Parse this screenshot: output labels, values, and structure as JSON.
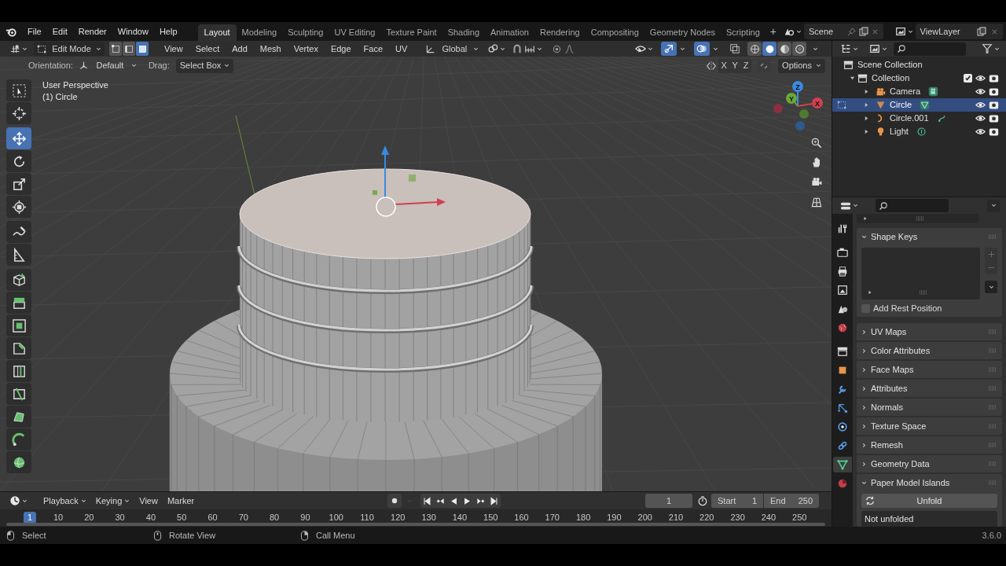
{
  "top_bar": {
    "menus": [
      "File",
      "Edit",
      "Render",
      "Window",
      "Help"
    ],
    "workspaces": [
      {
        "label": "Layout",
        "selected": true
      },
      {
        "label": "Modeling",
        "selected": false
      },
      {
        "label": "Sculpting",
        "selected": false
      },
      {
        "label": "UV Editing",
        "selected": false
      },
      {
        "label": "Texture Paint",
        "selected": false
      },
      {
        "label": "Shading",
        "selected": false
      },
      {
        "label": "Animation",
        "selected": false
      },
      {
        "label": "Rendering",
        "selected": false
      },
      {
        "label": "Compositing",
        "selected": false
      },
      {
        "label": "Geometry Nodes",
        "selected": false
      },
      {
        "label": "Scripting",
        "selected": false
      }
    ],
    "add_workspace": "+",
    "scene": "Scene",
    "view_layer": "ViewLayer"
  },
  "viewport_header": {
    "mode": "Edit Mode",
    "select_modes": [
      {
        "kind": "vertex",
        "selected": false
      },
      {
        "kind": "edge",
        "selected": false
      },
      {
        "kind": "face",
        "selected": true
      }
    ],
    "menus": [
      "View",
      "Select",
      "Add",
      "Mesh",
      "Vertex",
      "Edge",
      "Face",
      "UV"
    ],
    "orientation": "Global",
    "toggles": [
      {
        "kind": "gizmo",
        "on": true
      },
      {
        "kind": "overlay",
        "on": true
      },
      {
        "kind": "xray",
        "on": false
      }
    ],
    "shading": [
      {
        "kind": "wireframe",
        "selected": false
      },
      {
        "kind": "solid",
        "selected": true
      },
      {
        "kind": "material",
        "selected": false
      },
      {
        "kind": "rendered",
        "selected": false
      }
    ]
  },
  "tool_settings": {
    "orientation_label": "Orientation:",
    "orientation": "Default",
    "drag_label": "Drag:",
    "drag": "Select Box",
    "mirror_axes": [
      "X",
      "Y",
      "Z"
    ],
    "options": "Options"
  },
  "viewport": {
    "view_name": "User Perspective",
    "object_name": "(1) Circle",
    "axes": [
      "Z",
      "Y",
      "X"
    ]
  },
  "toolbar": [
    {
      "kind": "select_box",
      "selected": false
    },
    {
      "kind": "cursor",
      "selected": false
    },
    {
      "kind": "move",
      "selected": true
    },
    {
      "kind": "rotate",
      "selected": false
    },
    {
      "kind": "scale",
      "selected": false
    },
    {
      "kind": "transform",
      "selected": false
    },
    {
      "kind": "annotate",
      "selected": false
    },
    {
      "kind": "measure",
      "selected": false
    },
    {
      "kind": "add_cube",
      "selected": false
    },
    {
      "kind": "extrude",
      "selected": false
    },
    {
      "kind": "inset",
      "selected": false
    },
    {
      "kind": "bevel",
      "selected": false
    },
    {
      "kind": "loop_cut",
      "selected": false
    },
    {
      "kind": "knife",
      "selected": false
    },
    {
      "kind": "poly_build",
      "selected": false
    },
    {
      "kind": "spin",
      "selected": false
    },
    {
      "kind": "smooth",
      "selected": false
    }
  ],
  "outliner": {
    "root": "Scene Collection",
    "collections": [
      {
        "label": "Collection",
        "checked": true,
        "expanded": true,
        "children": [
          {
            "label": "Camera",
            "kind": "camera",
            "selected": false
          },
          {
            "label": "Circle",
            "kind": "mesh",
            "selected": true
          },
          {
            "label": "Circle.001",
            "kind": "curve",
            "selected": false
          },
          {
            "label": "Light",
            "kind": "light",
            "selected": false
          }
        ]
      }
    ]
  },
  "properties": {
    "tabs": [
      {
        "kind": "tool",
        "selected": false
      },
      {
        "kind": "render",
        "selected": false
      },
      {
        "kind": "output",
        "selected": false
      },
      {
        "kind": "view_layer",
        "selected": false
      },
      {
        "kind": "scene",
        "selected": false
      },
      {
        "kind": "world",
        "selected": false
      },
      {
        "kind": "collection",
        "selected": false
      },
      {
        "kind": "object",
        "selected": false
      },
      {
        "kind": "modifiers",
        "selected": false
      },
      {
        "kind": "particles",
        "selected": false
      },
      {
        "kind": "physics",
        "selected": false
      },
      {
        "kind": "constraints",
        "selected": false
      },
      {
        "kind": "data",
        "selected": true
      },
      {
        "kind": "material",
        "selected": false
      }
    ],
    "shape_keys": {
      "title": "Shape Keys",
      "expanded": true,
      "add_rest_position": {
        "label": "Add Rest Position",
        "checked": false
      }
    },
    "panels": [
      {
        "title": "UV Maps",
        "expanded": false
      },
      {
        "title": "Color Attributes",
        "expanded": false
      },
      {
        "title": "Face Maps",
        "expanded": false
      },
      {
        "title": "Attributes",
        "expanded": false
      },
      {
        "title": "Normals",
        "expanded": false
      },
      {
        "title": "Texture Space",
        "expanded": false
      },
      {
        "title": "Remesh",
        "expanded": false
      },
      {
        "title": "Geometry Data",
        "expanded": false
      },
      {
        "title": "Paper Model Islands",
        "expanded": true
      }
    ],
    "unfold_button": "Unfold",
    "unfold_status": "Not unfolded"
  },
  "timeline": {
    "menus": [
      "Playback",
      "Keying",
      "View",
      "Marker"
    ],
    "current_frame": "1",
    "start_label": "Start",
    "start": "1",
    "end_label": "End",
    "end": "250",
    "ruler": [
      {
        "label": "1",
        "selected": true
      },
      {
        "label": "10",
        "selected": false
      },
      {
        "label": "20",
        "selected": false
      },
      {
        "label": "30",
        "selected": false
      },
      {
        "label": "40",
        "selected": false
      },
      {
        "label": "50",
        "selected": false
      },
      {
        "label": "60",
        "selected": false
      },
      {
        "label": "70",
        "selected": false
      },
      {
        "label": "80",
        "selected": false
      },
      {
        "label": "90",
        "selected": false
      },
      {
        "label": "100",
        "selected": false
      },
      {
        "label": "110",
        "selected": false
      },
      {
        "label": "120",
        "selected": false
      },
      {
        "label": "130",
        "selected": false
      },
      {
        "label": "140",
        "selected": false
      },
      {
        "label": "150",
        "selected": false
      },
      {
        "label": "160",
        "selected": false
      },
      {
        "label": "170",
        "selected": false
      },
      {
        "label": "180",
        "selected": false
      },
      {
        "label": "190",
        "selected": false
      },
      {
        "label": "200",
        "selected": false
      },
      {
        "label": "210",
        "selected": false
      },
      {
        "label": "220",
        "selected": false
      },
      {
        "label": "230",
        "selected": false
      },
      {
        "label": "240",
        "selected": false
      },
      {
        "label": "250",
        "selected": false
      }
    ]
  },
  "status_bar": {
    "hints": [
      {
        "kind": "left_click",
        "label": "Select"
      },
      {
        "kind": "middle_click",
        "label": "Rotate View"
      },
      {
        "kind": "right_click",
        "label": "Call Menu"
      }
    ],
    "version": "3.6.0"
  }
}
